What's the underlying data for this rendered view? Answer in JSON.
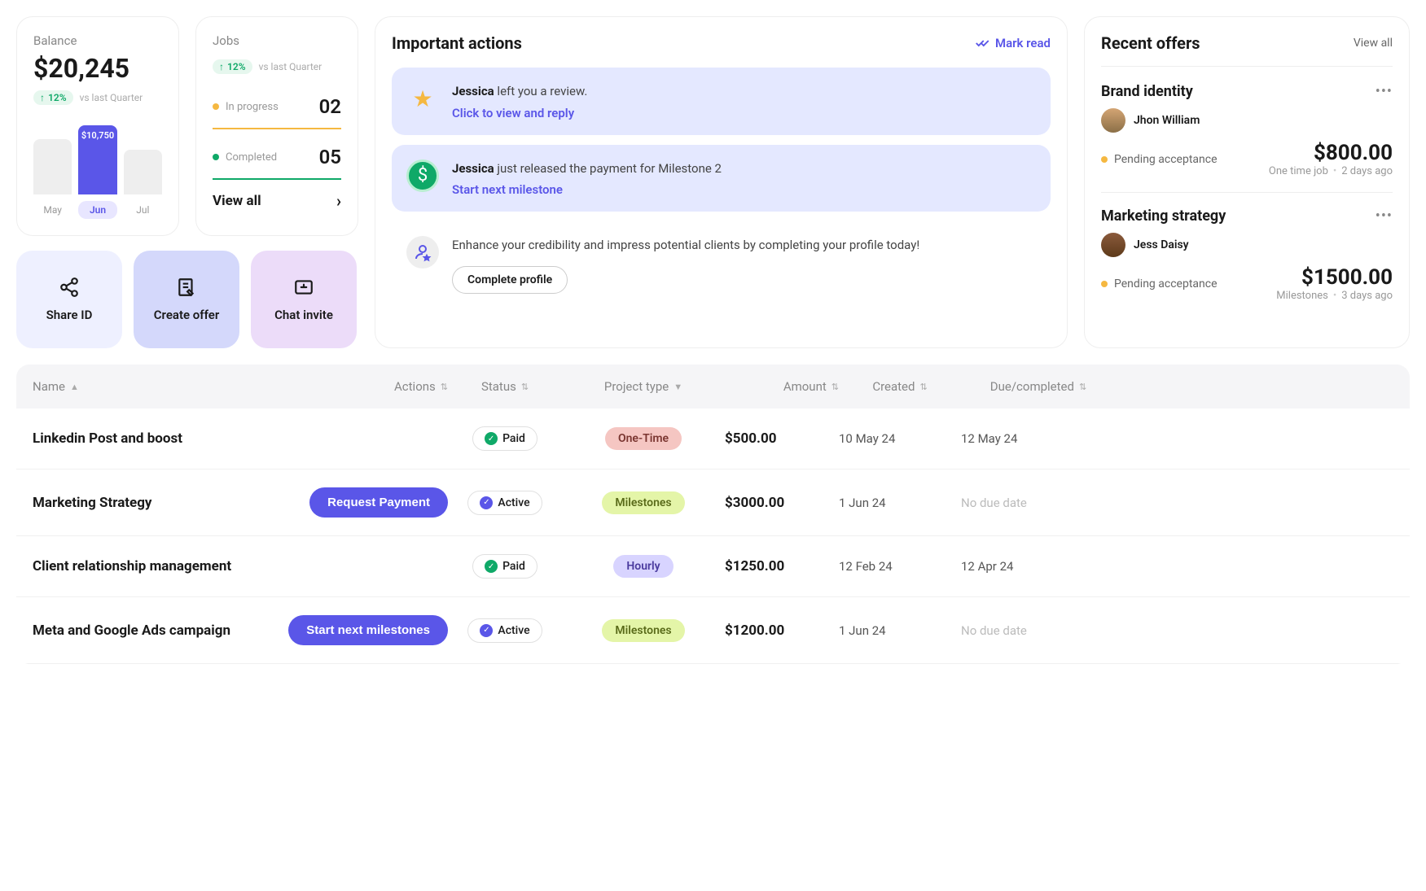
{
  "balance": {
    "label": "Balance",
    "amount": "$20,245",
    "trend": "12%",
    "trend_label": "vs last Quarter",
    "bar_label": "$10,750",
    "months": [
      "May",
      "Jun",
      "Jul"
    ]
  },
  "jobs": {
    "label": "Jobs",
    "trend": "12%",
    "trend_label": "vs last Quarter",
    "in_progress_label": "In progress",
    "in_progress_count": "02",
    "completed_label": "Completed",
    "completed_count": "05",
    "view_all": "View all"
  },
  "quick": {
    "share": "Share ID",
    "create": "Create offer",
    "chat": "Chat invite"
  },
  "actions": {
    "title": "Important actions",
    "mark_read": "Mark read",
    "items": {
      "review_prefix": "Jessica",
      "review_text": " left you a review.",
      "review_link": "Click to view and reply",
      "payment_prefix": "Jessica",
      "payment_text": " just released the payment for Milestone 2",
      "payment_link": "Start next milestone",
      "profile_text": "Enhance your credibility and impress potential clients by completing your profile today!",
      "profile_btn": "Complete profile"
    }
  },
  "offers": {
    "title": "Recent offers",
    "view_all": "View all",
    "items": [
      {
        "title": "Brand identity",
        "user": "Jhon William",
        "price": "$800.00",
        "status": "Pending acceptance",
        "type": "One time job",
        "age": "2 days ago"
      },
      {
        "title": "Marketing strategy",
        "user": "Jess Daisy",
        "price": "$1500.00",
        "status": "Pending acceptance",
        "type": "Milestones",
        "age": "3 days ago"
      }
    ]
  },
  "table": {
    "headers": {
      "name": "Name",
      "actions": "Actions",
      "status": "Status",
      "type": "Project type",
      "amount": "Amount",
      "created": "Created",
      "due": "Due/completed"
    },
    "rows": [
      {
        "name": "Linkedin Post and boost",
        "action": "",
        "status": "Paid",
        "status_kind": "green",
        "type": "One-Time",
        "type_kind": "onetime",
        "amount": "$500.00",
        "created": "10 May 24",
        "due": "12 May 24",
        "due_muted": false
      },
      {
        "name": "Marketing Strategy",
        "action": "Request Payment",
        "status": "Active",
        "status_kind": "purple",
        "type": "Milestones",
        "type_kind": "milestones",
        "amount": "$3000.00",
        "created": "1 Jun 24",
        "due": "No due date",
        "due_muted": true
      },
      {
        "name": "Client relationship management",
        "action": "",
        "status": "Paid",
        "status_kind": "green",
        "type": "Hourly",
        "type_kind": "hourly",
        "amount": "$1250.00",
        "created": "12 Feb 24",
        "due": "12 Apr 24",
        "due_muted": false
      },
      {
        "name": "Meta and Google Ads campaign",
        "action": "Start next milestones",
        "status": "Active",
        "status_kind": "purple",
        "type": "Milestones",
        "type_kind": "milestones",
        "amount": "$1200.00",
        "created": "1 Jun 24",
        "due": "No due date",
        "due_muted": true
      }
    ]
  }
}
